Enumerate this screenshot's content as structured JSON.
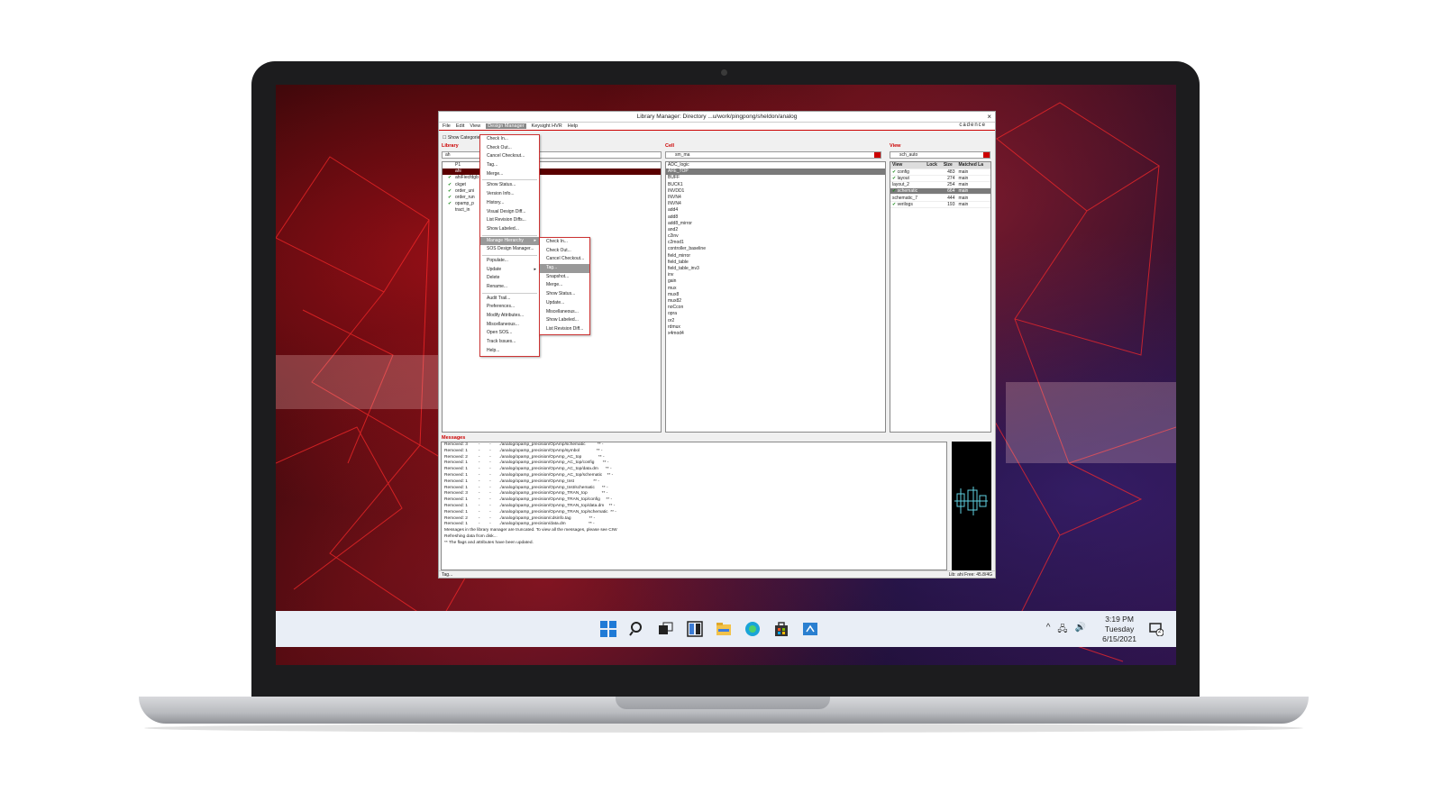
{
  "window": {
    "title": "Library Manager: Directory ...u/work/pingpong/sheldon/analog",
    "close": "×",
    "brand": "cadence"
  },
  "menubar": [
    "File",
    "Edit",
    "View",
    "Design Manager",
    "Keysight HVR",
    "Help"
  ],
  "show_categories": "Show Categories",
  "library": {
    "header": "Library",
    "filter_value": "ah",
    "items": [
      {
        "label": "P1",
        "check": false
      },
      {
        "label": "ahi",
        "check": false,
        "selected": true
      },
      {
        "label": "ahiFiecfdgb",
        "check": true
      },
      {
        "label": "ckget",
        "check": true
      },
      {
        "label": "order_uni",
        "check": true
      },
      {
        "label": "order_run",
        "check": true
      },
      {
        "label": "opamp_p",
        "check": true
      },
      {
        "label": "tract_in",
        "check": false
      }
    ]
  },
  "cell": {
    "header": "Cell",
    "filter_value": "sm_ma",
    "items": [
      "ADC_logic",
      "AFE_TOP",
      "BUFF",
      "BUCK1",
      "INVDD1",
      "INVN4",
      "INVN4",
      "add4",
      "add8",
      "add8_mirror",
      "and2",
      "c2inv",
      "c2mod1",
      "controller_baseline",
      "field_mirror",
      "field_table",
      "field_table_inv3",
      "inv",
      "gain",
      "mux",
      "mux8",
      "mux82",
      "noCcon",
      "opra",
      "or2",
      "rdmux",
      "x4mod4"
    ],
    "selected_index": 1
  },
  "view": {
    "header": "View",
    "filter_value": "sch_auto",
    "columns": [
      "View",
      "Lock",
      "Size",
      "Matched La"
    ],
    "rows": [
      {
        "name": "config",
        "check": true,
        "lock": "",
        "size": "483",
        "matched": "main"
      },
      {
        "name": "layout",
        "check": true,
        "lock": "",
        "size": "274",
        "matched": "main"
      },
      {
        "name": "layout_2",
        "check": false,
        "lock": "",
        "size": "254",
        "matched": "main"
      },
      {
        "name": "schematic",
        "check": true,
        "lock": "",
        "size": "664",
        "matched": "main",
        "selected": true
      },
      {
        "name": "schematic_7",
        "check": false,
        "lock": "",
        "size": "444",
        "matched": "main"
      },
      {
        "name": "verilogs",
        "check": true,
        "lock": "",
        "size": "193",
        "matched": "main"
      }
    ]
  },
  "dm_menu": [
    "Check In...",
    "Check Out...",
    "Cancel Checkout...",
    "Tag...",
    "Merge...",
    "---",
    "Show Status...",
    "Version Info...",
    "History...",
    "Visual Design Diff...",
    "List Revision Diffs...",
    "Show Labeled...",
    "---",
    "Manage Hierarchy",
    "SOS Design Manager...",
    "---",
    "Populate...",
    "Update",
    "Delete",
    "Rename...",
    "---",
    "Audit Trail...",
    "Preferences...",
    "Modify Attributes...",
    "Miscellaneous...",
    "Open SOS...",
    "Track Issues...",
    "Help..."
  ],
  "submenu": [
    "Check In...",
    "Check Out...",
    "Cancel Checkout...",
    "Tag...",
    "Snapshot...",
    "Merge...",
    "Show Status...",
    "Update...",
    "Miscellaneous...",
    "Show Labeled...",
    "List Revision Diff..."
  ],
  "messages": {
    "header": "Messages",
    "lines": [
      "Removed: 3         -        -       ./analog/opamp_precision/OpAmp/schematic          ** -",
      "Removed: 1         -        -       ./analog/opamp_precision/OpAmp/symbol              ** -",
      "Removed: 2         -        -       ./analog/opamp_precision/OpAmp_AC_top              ** -",
      "Removed: 1         -        -       ./analog/opamp_precision/OpAmp_AC_top/config       ** -",
      "Removed: 1         -        -       ./analog/opamp_precision/OpAmp_AC_top/data.dm      ** -",
      "Removed: 1         -        -       ./analog/opamp_precision/OpAmp_AC_top/schematic    ** -",
      "Removed: 1         -        -       ./analog/opamp_precision/OpAmp_tnst                ** -",
      "Removed: 1         -        -       ./analog/opamp_precision/OpAmp_tnst/schematic      ** -",
      "Removed: 3         -        -       ./analog/opamp_precision/OpAmp_TRAN_top            ** -",
      "Removed: 1         -        -       ./analog/opamp_precision/OpAmp_TRAN_top/config     ** -",
      "Removed: 1         -        -       ./analog/opamp_precision/OpAmp_TRAN_top/data.dm    ** -",
      "Removed: 1         -        -       ./analog/opamp_precision/OpAmp_TRAN_top/schematic  ** -",
      "Removed: 2         -        -       ./analog/opamp_precision/cdsinfo.tag               ** -",
      "Removed: 1         -        -       ./analog/opamp_precision/data.dm                   ** -",
      "Messages in the library manager are truncated. To view all the messages, please see CIW",
      "Refreshing data from disk...",
      "** The flags and attributes have been updated."
    ]
  },
  "statusbar": {
    "left": "Tag...",
    "right": "Lib: ahi  Free: 45.8/4G"
  },
  "taskbar": {
    "icons": [
      "windows-start-icon",
      "search-icon",
      "task-view-icon",
      "widgets-icon",
      "file-explorer-icon",
      "edge-browser-icon",
      "store-icon",
      "app-icon"
    ],
    "time": "3:19 PM",
    "day": "Tuesday",
    "date": "6/15/2021",
    "tray": [
      "^",
      "🖧",
      "🔊"
    ],
    "notification_count": "2"
  }
}
